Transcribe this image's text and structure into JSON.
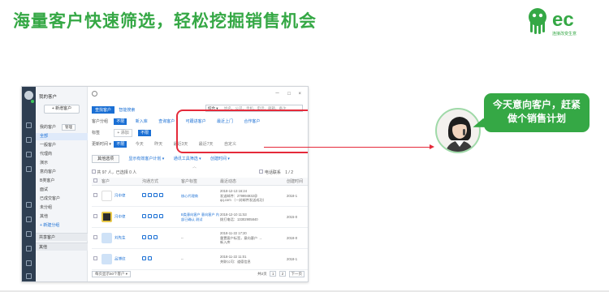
{
  "headline": "海量客户快速筛选，轻松挖掘销售机会",
  "logo": {
    "mark": "ec",
    "tagline": "连接改变生意"
  },
  "bubble": {
    "text": "今天意向客户，赶紧做个销售计划"
  },
  "colors": {
    "brand_green": "#35a845",
    "accent_blue": "#1a6fd4",
    "highlight_red": "#e52a3a",
    "sidebar_dark": "#2e3e51"
  },
  "app": {
    "left_title": "我的客户",
    "new_button": "+ 新增客户",
    "nav": [
      {
        "label": "我的客户",
        "extra": "管理"
      },
      {
        "label": "全部"
      },
      {
        "label": "一般客户"
      },
      {
        "label": "代理商"
      },
      {
        "label": "演示"
      },
      {
        "label": "意向客户"
      },
      {
        "label": "B类客户"
      },
      {
        "label": "面试"
      },
      {
        "label": "已成交客户"
      },
      {
        "label": "未分组"
      },
      {
        "label": "其他"
      },
      {
        "label": "+ 新建分组"
      }
    ],
    "folds": [
      {
        "label": "共享客户"
      },
      {
        "label": "其他"
      }
    ],
    "window_controls": "－ □ ×",
    "tabs": [
      {
        "label": "查找客户"
      },
      {
        "label": "智能搜索"
      }
    ],
    "search": {
      "select": "综合 ▾",
      "placeholder": "姓名、公司、手机、电话、邮箱、备注"
    },
    "filters": [
      {
        "label": "客户分组",
        "chips": [
          "不限",
          "新入库",
          "查询客户",
          "可跟进客户",
          "最近上门",
          "合作客户"
        ]
      },
      {
        "label": "标签",
        "chips": [
          "+ 添加",
          "不限"
        ]
      },
      {
        "label": "更新时间 ▾",
        "chips": [
          "不限",
          "今天",
          "昨天",
          "最近3天",
          "最近7天",
          "自定义"
        ]
      }
    ],
    "toolbar": {
      "more_filters": "其他选项",
      "links": [
        "显示有效客户计划 ▾",
        "通讯工具筛选 ▾",
        "创建时间 ▾"
      ]
    },
    "count_text": "共 97 人，已选择 0 人",
    "collapse": "︿",
    "table_tools": {
      "check_label": "电话联系",
      "pager": "1 / 2"
    },
    "columns": [
      "客户",
      "沟通方式",
      "客户标签",
      "最近动态",
      "创建时间"
    ],
    "rows": [
      {
        "name": "冯中律",
        "tags": "核心代理商",
        "dyn1": "2018-12-13 16:24",
        "dyn2": "发送邮件：279994932@",
        "dyn3": "qq.com （一封邮件发送成功）",
        "created": "2018-1"
      },
      {
        "name": "冯中律",
        "tags": "B类意向客户 意向客户 内部已确认 测试",
        "dyn1": "2018-12-10 11:53",
        "dyn2": "拨打电话：13302905840",
        "dyn3": "",
        "created": "2015-0"
      },
      {
        "name": "刘先生",
        "tags": "--",
        "dyn1": "2018-11-22 17:20",
        "dyn2": "重置客户标签，意向客户 →",
        "dyn3": "新入库",
        "created": "2018-0"
      },
      {
        "name": "吕博纹",
        "tags": "--",
        "dyn1": "2018-11-22 11:01",
        "dyn2": "关联公司：道德信息",
        "dyn3": "",
        "created": "2018-1"
      }
    ],
    "pager": {
      "page_size": "每页显示50个客户 ▾",
      "total": "共2页",
      "pages": [
        "1",
        "2"
      ],
      "next": "下一页"
    }
  }
}
